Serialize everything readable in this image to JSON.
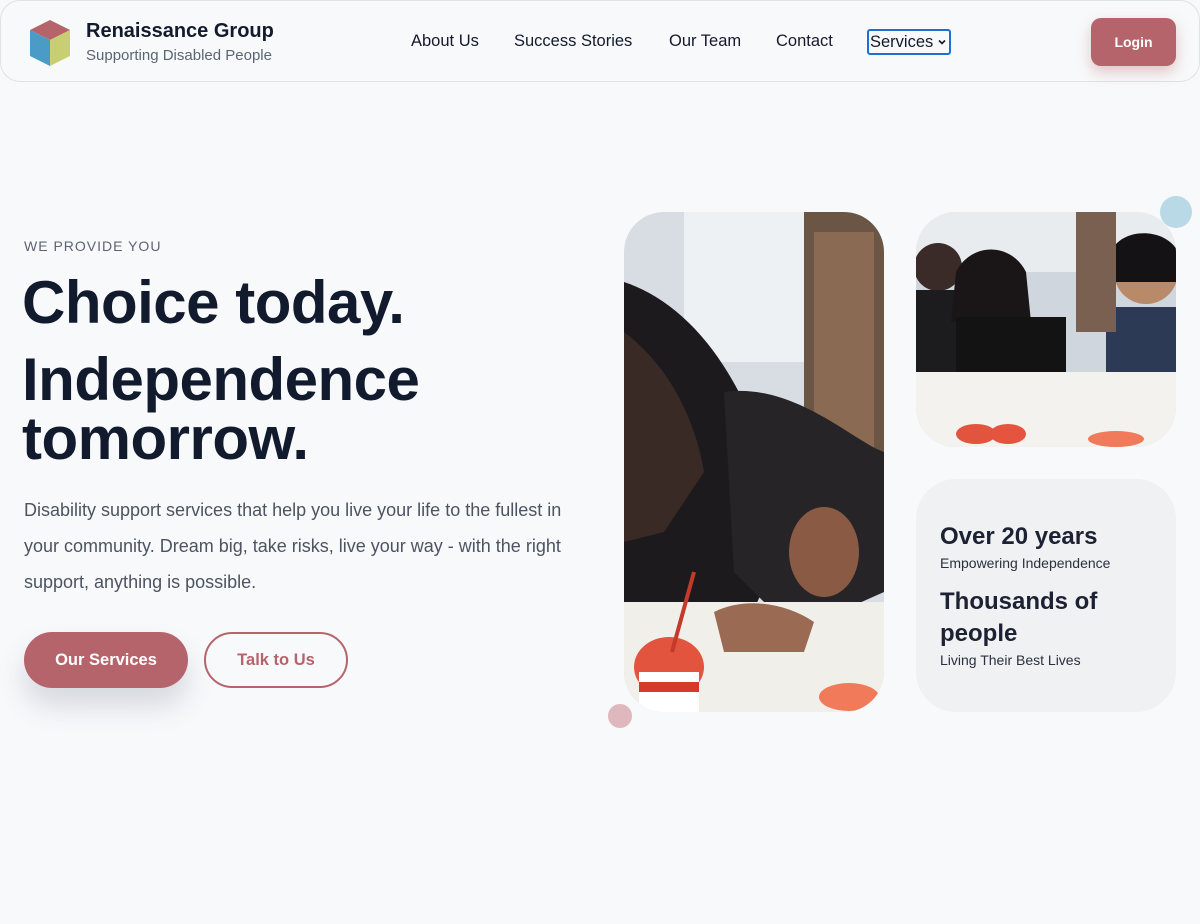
{
  "brand": {
    "name": "Renaissance Group",
    "tagline": "Supporting Disabled People",
    "logo_colors": {
      "top": "#b5646b",
      "left": "#4a9cc7",
      "right": "#c8cf72"
    }
  },
  "nav": {
    "items": [
      "About Us",
      "Success Stories",
      "Our Team",
      "Contact"
    ],
    "services_label": "Services",
    "login_label": "Login"
  },
  "hero": {
    "eyebrow": "WE PROVIDE YOU",
    "headline_line1": "Choice today.",
    "headline_line2": "Independence",
    "headline_line3": "tomorrow.",
    "lead": "Disability support services that help you live your life to the fullest in your community. Dream big, take risks, live your way - with the right support, anything is possible.",
    "primary_cta": "Our Services",
    "secondary_cta": "Talk to Us"
  },
  "stats": [
    {
      "title": "Over 20 years",
      "subtitle": "Empowering Independence"
    },
    {
      "title": "Thousands of people",
      "subtitle": "Living Their Best Lives"
    }
  ],
  "colors": {
    "accent": "#b5646b",
    "background": "#f8f9fb",
    "heading": "#121a2e",
    "dot_blue": "#b9d9e6",
    "dot_pink": "#dfb8bd"
  }
}
